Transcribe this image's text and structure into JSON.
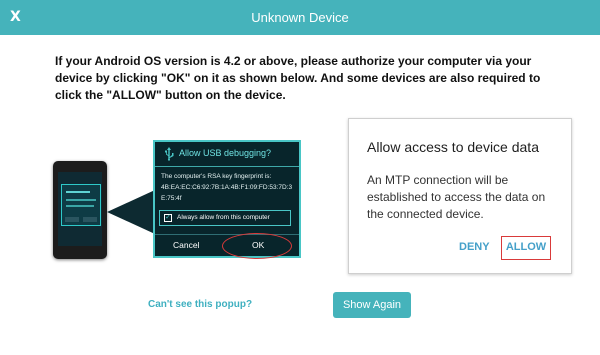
{
  "window": {
    "title": "Unknown Device",
    "close_label": "X",
    "accent_color": "#45b3bb"
  },
  "instructions": "If your Android OS version is 4.2 or above, please authorize your computer via your device by clicking \"OK\" on it as shown below. And some devices are also required to click the \"ALLOW\" button on the device.",
  "usb_dialog": {
    "icon": "usb-icon",
    "title": "Allow USB debugging?",
    "fingerprint_label": "The computer's RSA key fingerprint is:",
    "fingerprint_value": "4B:EA:EC:C6:92:7B:1A:4B:F1:09:FD:53:7D:3E:75:4f",
    "checkbox_label": "Always allow from this computer",
    "cancel_label": "Cancel",
    "ok_label": "OK"
  },
  "permission_dialog": {
    "title": "Allow access to device data",
    "body": "An MTP connection will be established to access the data on the connected device.",
    "deny_label": "DENY",
    "allow_label": "ALLOW"
  },
  "footer": {
    "help_link": "Can't see this popup?",
    "show_again_label": "Show Again"
  }
}
